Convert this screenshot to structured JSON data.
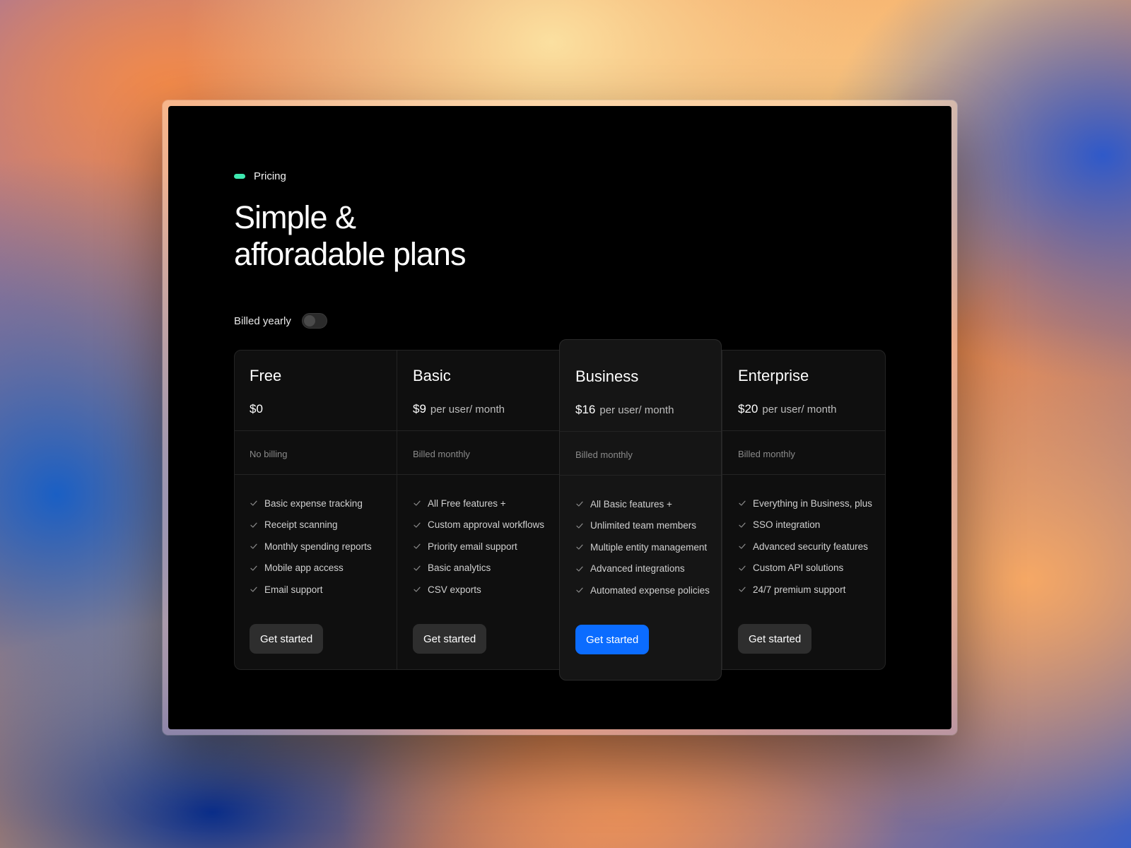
{
  "section": {
    "tag": "Pricing",
    "accent_color": "#3ee8b0",
    "headline_line1": "Simple &",
    "headline_line2": "afforadable plans"
  },
  "billing_toggle": {
    "label": "Billed yearly",
    "checked": false
  },
  "plans": [
    {
      "name": "Free",
      "price": "$0",
      "unit": "",
      "billing": "No billing",
      "features": [
        "Basic expense tracking",
        "Receipt scanning",
        "Monthly spending reports",
        "Mobile app access",
        "Email support"
      ],
      "cta": "Get started"
    },
    {
      "name": "Basic",
      "price": "$9",
      "unit": "per user/ month",
      "billing": "Billed monthly",
      "features": [
        "All Free features +",
        "Custom approval workflows",
        "Priority email support",
        "Basic analytics",
        "CSV exports"
      ],
      "cta": "Get started"
    },
    {
      "name": "Business",
      "price": "$16",
      "unit": "per user/ month",
      "billing": "Billed monthly",
      "features": [
        "All Basic features +",
        "Unlimited team members",
        "Multiple entity management",
        "Advanced integrations",
        "Automated expense policies"
      ],
      "cta": "Get started",
      "featured": true,
      "cta_color": "#0b6cff"
    },
    {
      "name": "Enterprise",
      "price": "$20",
      "unit": "per user/ month",
      "billing": "Billed monthly",
      "features": [
        "Everything in Business, plus",
        "SSO integration",
        "Advanced security features",
        "Custom API solutions",
        "24/7 premium support"
      ],
      "cta": "Get started"
    }
  ]
}
